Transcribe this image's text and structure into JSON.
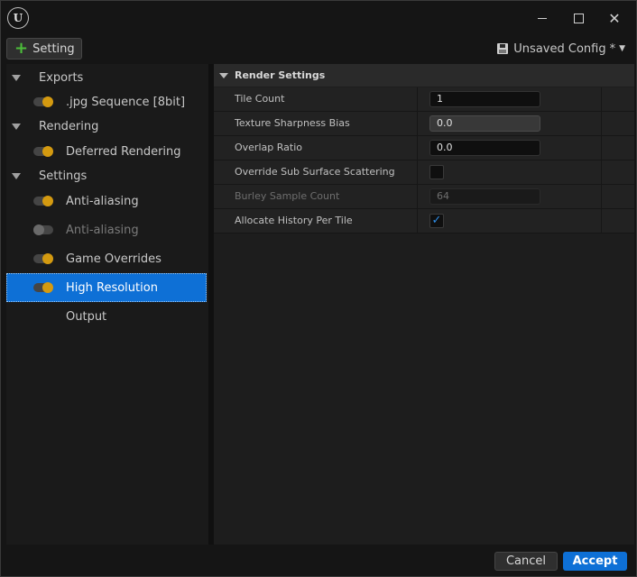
{
  "toolbar": {
    "setting_label": "Setting",
    "config_label": "Unsaved Config",
    "config_modified_marker": "*"
  },
  "tree": {
    "items": [
      {
        "label": "Exports",
        "kind": "category"
      },
      {
        "label": ".jpg Sequence [8bit]",
        "kind": "setting",
        "enabled": true
      },
      {
        "label": "Rendering",
        "kind": "category"
      },
      {
        "label": "Deferred Rendering",
        "kind": "setting",
        "enabled": true
      },
      {
        "label": "Settings",
        "kind": "category"
      },
      {
        "label": "Anti-aliasing",
        "kind": "setting",
        "enabled": true
      },
      {
        "label": "Anti-aliasing",
        "kind": "setting",
        "enabled": false
      },
      {
        "label": "Game Overrides",
        "kind": "setting",
        "enabled": true
      },
      {
        "label": "High Resolution",
        "kind": "setting",
        "enabled": true,
        "selected": true
      },
      {
        "label": "Output",
        "kind": "setting"
      }
    ]
  },
  "details": {
    "section_title": "Render Settings",
    "properties": [
      {
        "name": "Tile Count",
        "value": "1"
      },
      {
        "name": "Texture Sharpness Bias",
        "value": "0.0"
      },
      {
        "name": "Overlap Ratio",
        "value": "0.0"
      },
      {
        "name": "Override Sub Surface Scattering",
        "checked": false
      },
      {
        "name": "Burley Sample Count",
        "value": "64",
        "disabled": true
      },
      {
        "name": "Allocate History Per Tile",
        "checked": true
      }
    ]
  },
  "footer": {
    "cancel_label": "Cancel",
    "accept_label": "Accept"
  },
  "colors": {
    "accent": "#0e70d6",
    "toggle_on": "#d49a10",
    "add_icon": "#4cbf3a"
  }
}
